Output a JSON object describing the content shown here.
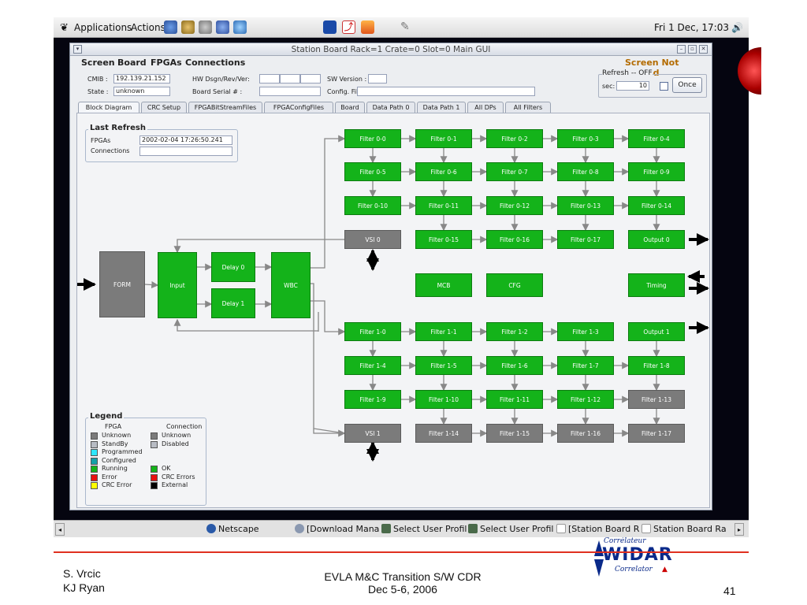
{
  "desktop_bar": {
    "applications": "Applications",
    "actions": "Actions",
    "clock": "Fri  1 Dec, 17:03"
  },
  "window": {
    "title": "Station Board  Rack=1 Crate=0 Slot=0  Main GUI",
    "menu": [
      "Screen",
      "Board",
      "FPGAs",
      "Connections"
    ],
    "lock_status": "Screen Not Locked"
  },
  "info": {
    "cmib_label": "CMIB :",
    "cmib_value": "192.139.21.152",
    "state_label": "State :",
    "state_value": "unknown",
    "hw_label": "HW Dsgn/Rev/Ver:",
    "board_serial_label": "Board Serial # :",
    "sw_version_label": "SW Version :",
    "config_file_label": "Config. File :",
    "refresh_title": "Refresh  -- OFF",
    "sec_label": "sec:",
    "sec_value": "10",
    "once_label": "Once"
  },
  "tabs": [
    "Block Diagram",
    "CRC Setup",
    "FPGABitStreamFiles",
    "FPGAConfigFiles",
    "Board",
    "Data Path 0",
    "Data Path 1",
    "All DPs",
    "All Filters"
  ],
  "last_refresh": {
    "title": "Last Refresh",
    "fpgas_label": "FPGAs",
    "fpgas_value": "2002-02-04 17:26:50.241",
    "connections_label": "Connections"
  },
  "blocks": {
    "form": "FORM",
    "input": "Input",
    "delay0": "Delay 0",
    "delay1": "Delay 1",
    "wbc": "WBC",
    "vsi0": "VSI 0",
    "vsi1": "VSI 1",
    "mcb": "MCB",
    "cfg": "CFG",
    "timing": "Timing",
    "output0": "Output 0",
    "output1": "Output 1",
    "filters0": [
      "Filter 0-0",
      "Filter 0-1",
      "Filter 0-2",
      "Filter 0-3",
      "Filter 0-4",
      "Filter 0-5",
      "Filter 0-6",
      "Filter 0-7",
      "Filter 0-8",
      "Filter 0-9",
      "Filter 0-10",
      "Filter 0-11",
      "Filter 0-12",
      "Filter 0-13",
      "Filter 0-14",
      "Filter 0-15",
      "Filter 0-16",
      "Filter 0-17"
    ],
    "filters1": [
      "Filter 1-0",
      "Filter 1-1",
      "Filter 1-2",
      "Filter 1-3",
      "Filter 1-4",
      "Filter 1-5",
      "Filter 1-6",
      "Filter 1-7",
      "Filter 1-8",
      "Filter 1-9",
      "Filter 1-10",
      "Filter 1-11",
      "Filter 1-12",
      "Filter 1-13",
      "Filter 1-14",
      "Filter 1-15",
      "Filter 1-16",
      "Filter 1-17"
    ]
  },
  "legend": {
    "title": "Legend",
    "fpga_header": "FPGA",
    "conn_header": "Connection",
    "fpga_items": [
      {
        "label": "Unknown",
        "color": "#7b7b7b"
      },
      {
        "label": "StandBy",
        "color": "#b8bcc4"
      },
      {
        "label": "Programmed",
        "color": "#2ee6ff"
      },
      {
        "label": "Configured",
        "color": "#14a0a8"
      },
      {
        "label": "Running",
        "color": "#14b31a"
      },
      {
        "label": "Error",
        "color": "#e81010"
      },
      {
        "label": "CRC Error",
        "color": "#ffff00"
      }
    ],
    "conn_items": [
      {
        "label": "Unknown",
        "color": "#7b7b7b"
      },
      {
        "label": "Disabled",
        "color": "#b8bcc4"
      },
      {
        "label": "OK",
        "color": "#14b31a"
      },
      {
        "label": "CRC Errors",
        "color": "#e81010"
      },
      {
        "label": "External",
        "color": "#000000"
      }
    ]
  },
  "logo": {
    "top": "Corrélateur",
    "main": "WIDAR",
    "bottom": "Correlator"
  },
  "taskbar": [
    "Netscape",
    "[Download Manag",
    "Select User Profil",
    "Select User Profil",
    "[Station Board  R",
    "Station Board  Ra"
  ],
  "footer": {
    "author1": "S. Vrcic",
    "author2": "KJ Ryan",
    "title": "EVLA M&C Transition S/W CDR",
    "date": "Dec 5-6, 2006",
    "page": "41"
  }
}
